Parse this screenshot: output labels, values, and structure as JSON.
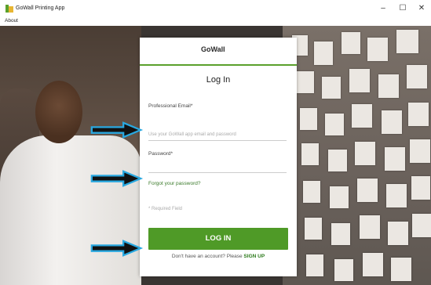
{
  "window": {
    "title": "GoWall Printing App",
    "menu": [
      "About"
    ],
    "controls": {
      "minimize": "–",
      "maximize": "☐",
      "close": "✕"
    }
  },
  "dialog": {
    "logo_text": "GoWall",
    "heading": "Log In",
    "email_label": "Professional Email*",
    "email_placeholder": "Use your GoWall app email and password",
    "password_label": "Password*",
    "forgot_link": "Forgot your password?",
    "required_note": "* Required Field",
    "login_button": "LOG IN",
    "signup_prompt": "Don't have an account? Please",
    "signup_link": "SIGN UP"
  },
  "colors": {
    "accent": "#4f9a27",
    "link": "#2b7a1a",
    "arrow": "#111111",
    "arrow_glow": "#29a8e0"
  }
}
